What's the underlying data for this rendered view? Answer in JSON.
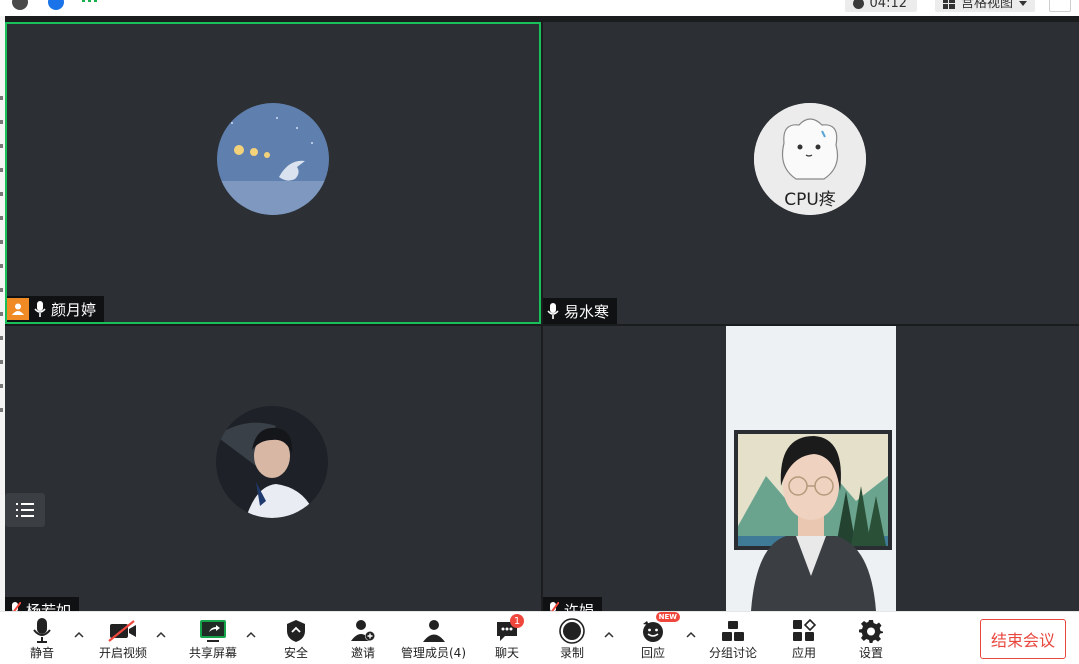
{
  "top_bar": {
    "timer": "04:12",
    "view_label": "宫格视图",
    "icons": [
      "info-icon",
      "shield-check-icon",
      "signal-icon",
      "clock-icon",
      "grid-view-icon",
      "fullscreen-icon"
    ]
  },
  "participants": [
    {
      "name": "颜月婷",
      "is_host": true,
      "mic": "on",
      "speaking": true,
      "media": "avatar"
    },
    {
      "name": "易水寒",
      "is_host": false,
      "mic": "on",
      "speaking": false,
      "media": "avatar",
      "avatar_caption": "CPU疼"
    },
    {
      "name": "杨若如",
      "is_host": false,
      "mic": "muted",
      "speaking": false,
      "media": "avatar"
    },
    {
      "name": "许娟",
      "is_host": false,
      "mic": "muted",
      "speaking": false,
      "media": "video"
    }
  ],
  "toolbar": {
    "mute": "静音",
    "video": "开启视频",
    "share": "共享屏幕",
    "security": "安全",
    "invite": "邀请",
    "members": "管理成员(4)",
    "chat": "聊天",
    "chat_badge": "1",
    "record": "录制",
    "react": "回应",
    "react_badge": "NEW",
    "breakout": "分组讨论",
    "apps": "应用",
    "settings": "设置",
    "end": "结束会议"
  },
  "colors": {
    "active_speaker_border": "#19c05a",
    "tile_bg": "#2c2f33",
    "end_button": "#e8473e",
    "host_badge": "#f08a24",
    "share_icon": "#16a34a"
  }
}
